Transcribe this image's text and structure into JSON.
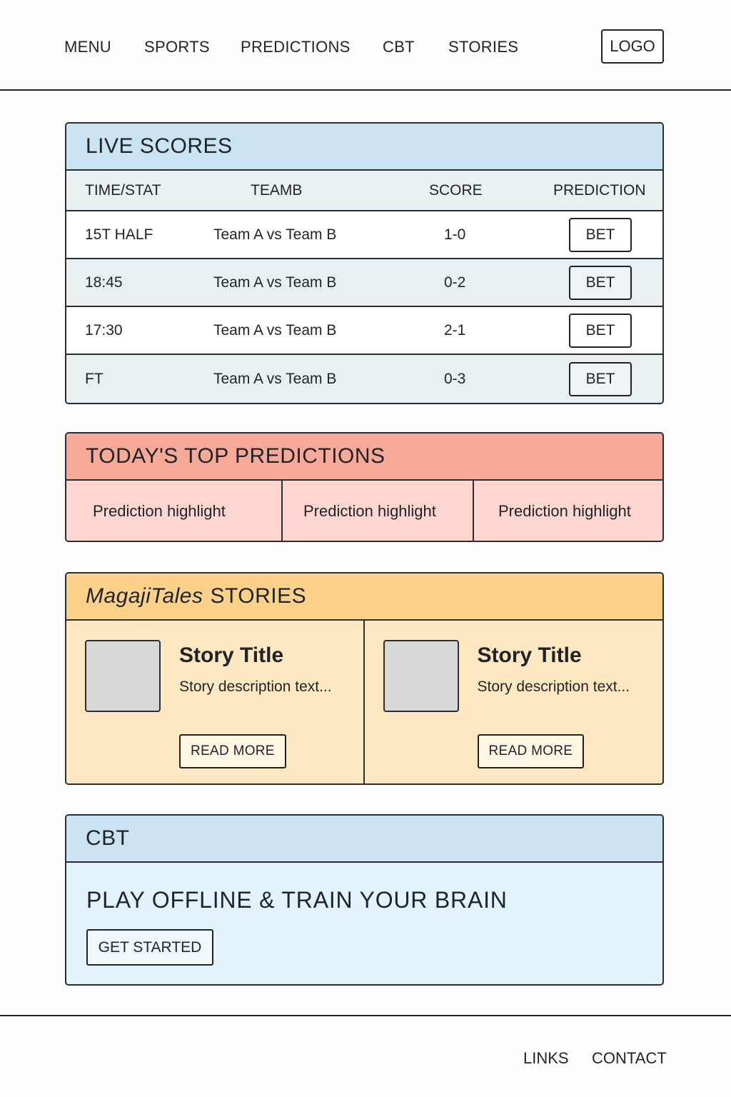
{
  "nav": {
    "items": [
      "MENU",
      "SPORTS",
      "PREDICTIONS",
      "CBT",
      "STORIES"
    ],
    "logo": "LOGO"
  },
  "live_scores": {
    "title": "LIVE SCORES",
    "columns": [
      "TIME/STAT",
      "TEAMB",
      "SCORE",
      "PREDICTION"
    ],
    "rows": [
      {
        "time": "15T HALF",
        "match": "Team A vs Team B",
        "score": "1-0",
        "action": "BET"
      },
      {
        "time": "18:45",
        "match": "Team A vs Team B",
        "score": "0-2",
        "action": "BET"
      },
      {
        "time": "17:30",
        "match": "Team A vs Team B",
        "score": "2-1",
        "action": "BET"
      },
      {
        "time": "FT",
        "match": "Team A vs Team B",
        "score": "0-3",
        "action": "BET"
      }
    ]
  },
  "predictions": {
    "title": "TODAY'S TOP PREDICTIONS",
    "items": [
      "Prediction highlight",
      "Prediction highlight",
      "Prediction highlight"
    ]
  },
  "stories": {
    "brand": "MagajiTales",
    "title": "STORIES",
    "items": [
      {
        "title": "Story Title",
        "description": "Story description text...",
        "button": "READ MORE"
      },
      {
        "title": "Story Title",
        "description": "Story description text...",
        "button": "READ MORE"
      }
    ]
  },
  "cbt": {
    "title": "CBT",
    "tagline": "PLAY OFFLINE & TRAIN YOUR BRAIN",
    "button": "GET STARTED"
  },
  "footer": {
    "links": [
      "LINKS",
      "CONTACT"
    ]
  },
  "colors": {
    "live_header": "#c9e3f2",
    "predictions_header": "#f7a998",
    "predictions_body": "#fdd6cf",
    "stories_header": "#fcd18a",
    "stories_body": "#fde8c2",
    "cbt_body": "#e2f3fc"
  }
}
